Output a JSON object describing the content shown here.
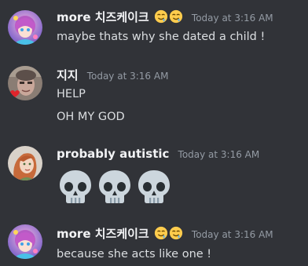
{
  "messages": [
    {
      "username": "more 치즈케이크",
      "username_emojis": [
        "drooling-face-emoji",
        "drooling-face-emoji"
      ],
      "timestamp": "Today at 3:16 AM",
      "lines": [
        "maybe thats why she dated a child !"
      ]
    },
    {
      "username": "지지",
      "timestamp": "Today at 3:16 AM",
      "lines": [
        "HELP",
        "OH MY GOD"
      ]
    },
    {
      "username": "probably autistic",
      "timestamp": "Today at 3:16 AM",
      "content_emojis": [
        "skull-emoji",
        "skull-emoji",
        "skull-emoji"
      ]
    },
    {
      "username": "more 치즈케이크",
      "username_emojis": [
        "drooling-face-emoji",
        "drooling-face-emoji"
      ],
      "timestamp": "Today at 3:16 AM",
      "lines": [
        "because she acts like one !"
      ]
    }
  ],
  "colors": {
    "background": "#313338",
    "username": "#f2f3f5",
    "timestamp": "#949ba4",
    "text": "#dbdee1"
  }
}
